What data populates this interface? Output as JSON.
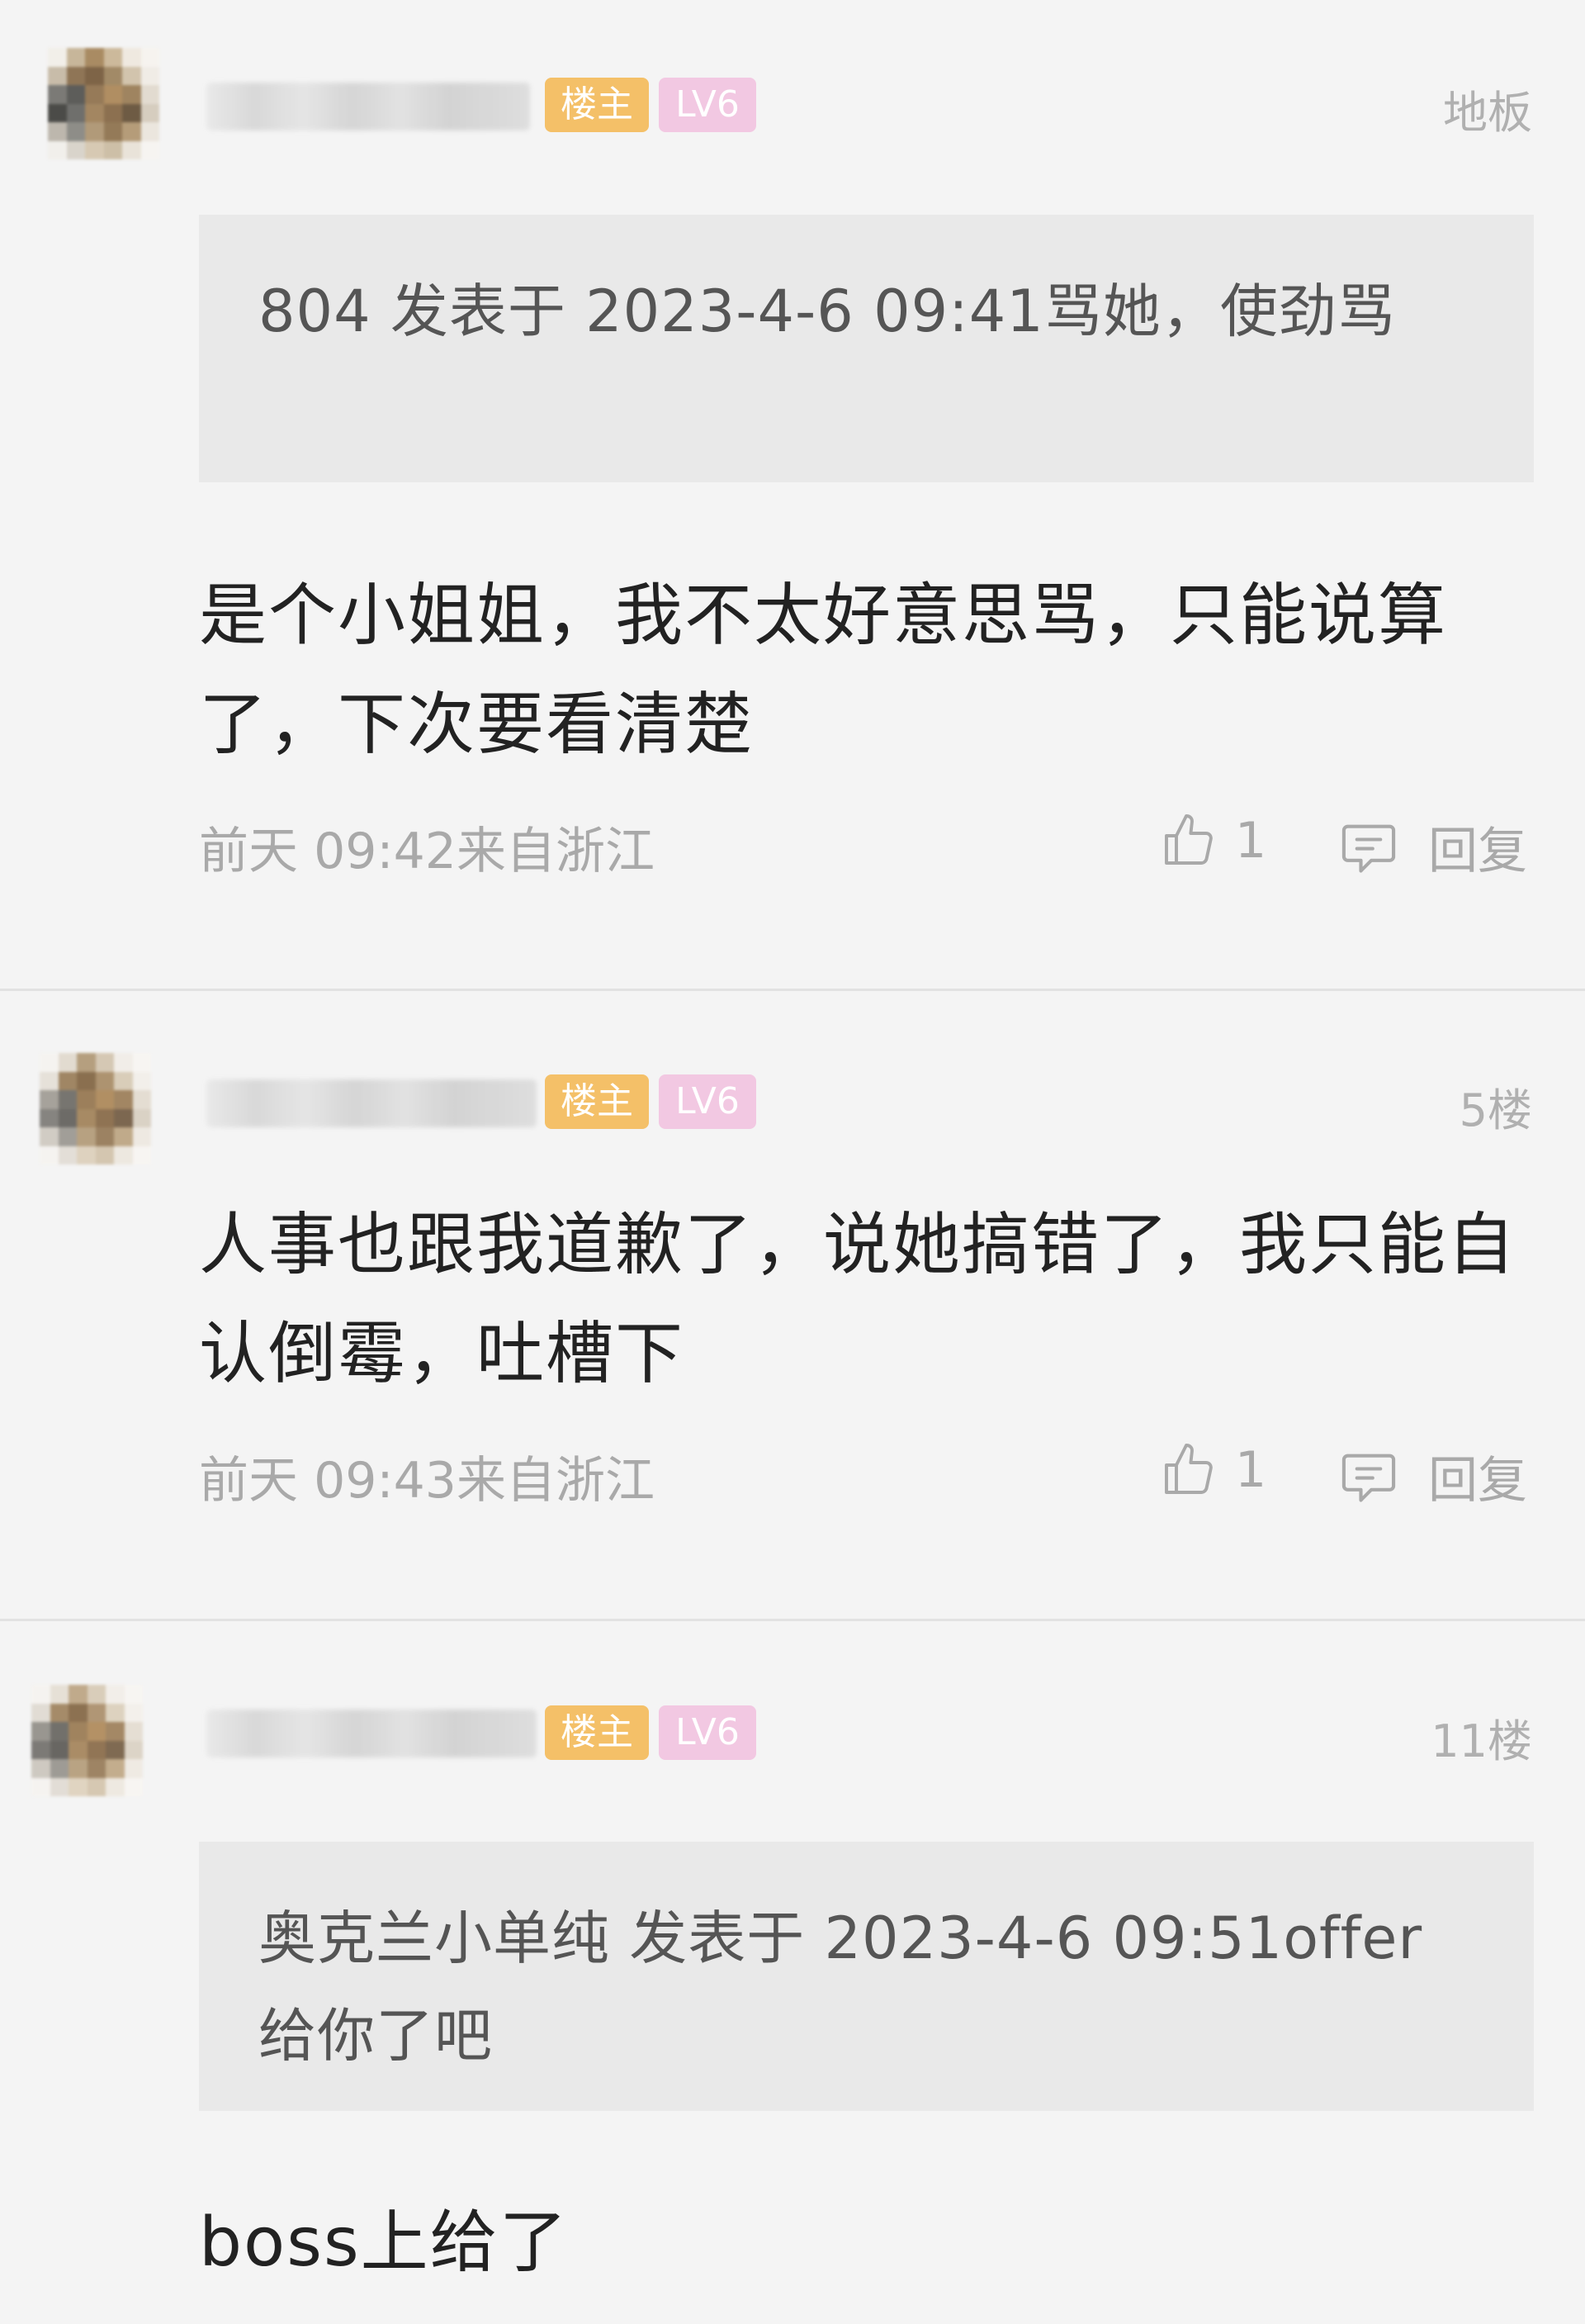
{
  "comments": [
    {
      "owner_badge": "楼主",
      "level_badge": "LV6",
      "floor": "地板",
      "quote": "804 发表于 2023-4-6 09:41骂她，使劲骂",
      "text": "是个小姐姐，我不太好意思骂，只能说算了，下次要看清楚",
      "meta": "前天 09:42来自浙江",
      "likes": "1",
      "reply_label": "回复"
    },
    {
      "owner_badge": "楼主",
      "level_badge": "LV6",
      "floor": "5楼",
      "text": "人事也跟我道歉了，说她搞错了，我只能自认倒霉，吐槽下",
      "meta": "前天 09:43来自浙江",
      "likes": "1",
      "reply_label": "回复"
    },
    {
      "owner_badge": "楼主",
      "level_badge": "LV6",
      "floor": "11楼",
      "quote": "奥克兰小单纯 发表于 2023-4-6 09:51offer给你了吧",
      "text": "boss上给了"
    }
  ],
  "colors": {
    "background": "#f4f4f4",
    "owner_badge": "#f4c068",
    "level_badge": "#f2c8e2",
    "quote_background": "#e9e9e9",
    "meta_text": "#a9a9a9"
  },
  "icons": {
    "like": "thumbs-up-icon",
    "reply": "speech-bubble-icon"
  }
}
